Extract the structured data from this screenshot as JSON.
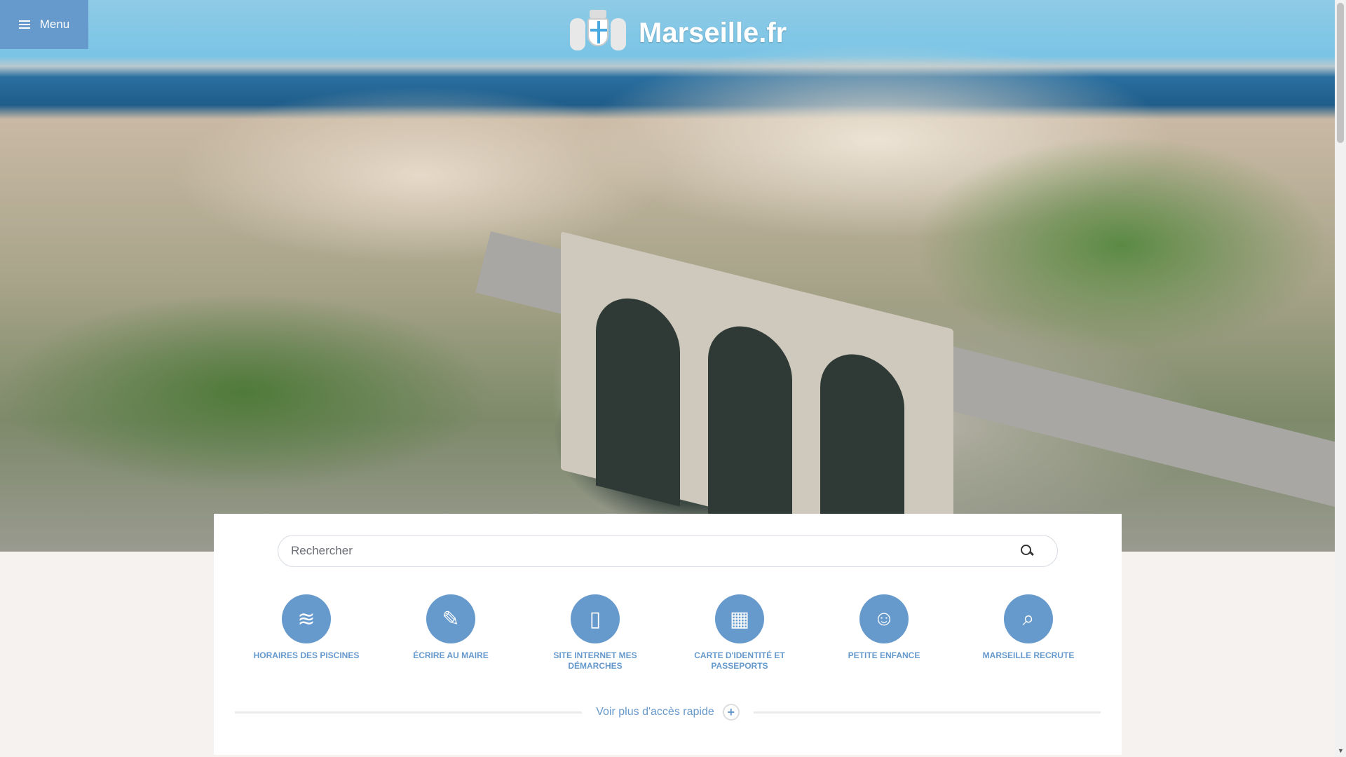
{
  "header": {
    "menu_label": "Menu",
    "logo_text": "Marseille.fr"
  },
  "search": {
    "placeholder": "Rechercher"
  },
  "quick_access": [
    {
      "label": "HORAIRES DES PISCINES",
      "icon": "pool-icon"
    },
    {
      "label": "ÉCRIRE AU MAIRE",
      "icon": "write-document-icon"
    },
    {
      "label": "SITE INTERNET MES DÉMARCHES",
      "icon": "smartphone-hand-icon"
    },
    {
      "label": "CARTE D'IDENTITÉ ET PASSEPORTS",
      "icon": "calendar-clock-icon"
    },
    {
      "label": "PETITE ENFANCE",
      "icon": "baby-face-icon"
    },
    {
      "label": "MARSEILLE RECRUTE",
      "icon": "briefcase-search-icon"
    }
  ],
  "more": {
    "label": "Voir plus d'accès rapide"
  },
  "colors": {
    "accent": "#6699cc",
    "background": "#f5f2f0"
  }
}
